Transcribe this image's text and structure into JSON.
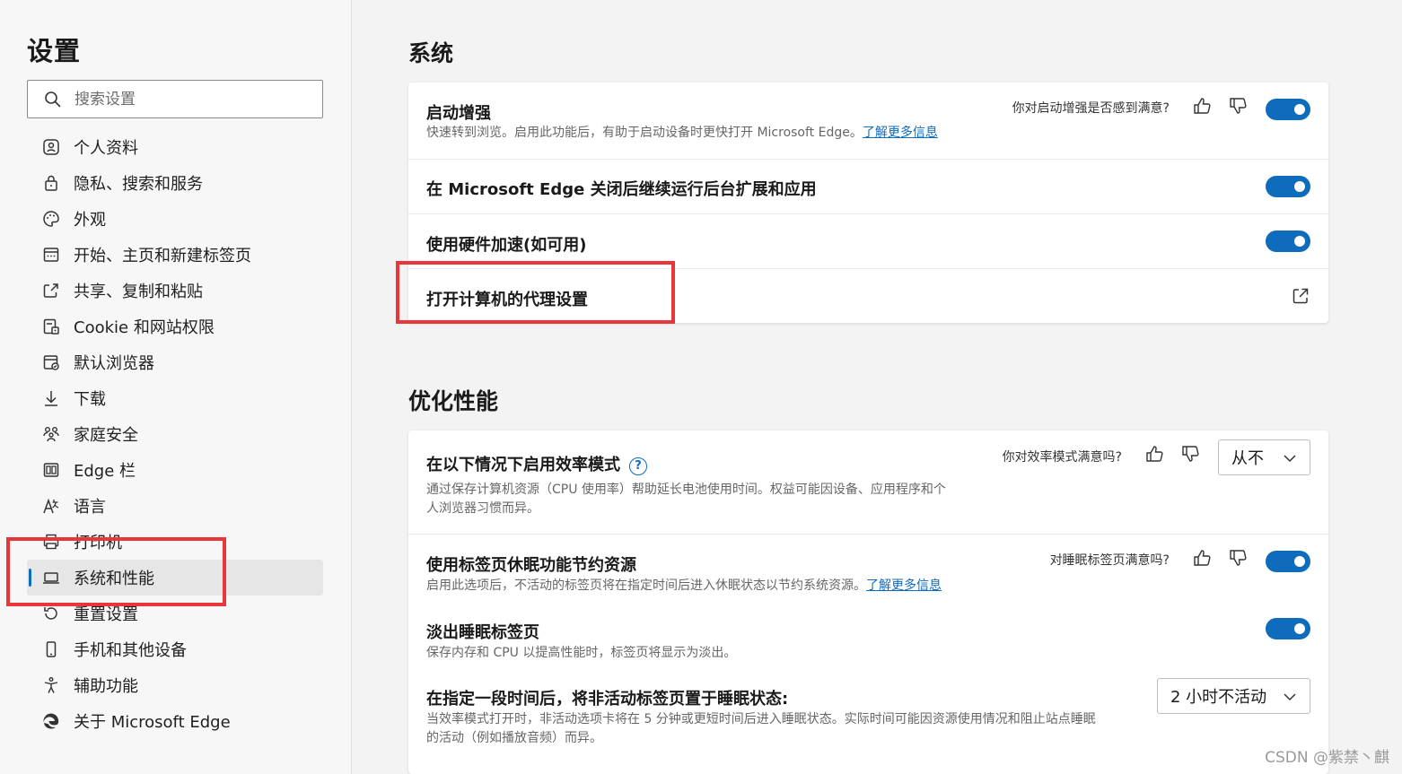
{
  "sidebar": {
    "title": "设置",
    "search_placeholder": "搜索设置",
    "items": [
      {
        "label": "个人资料",
        "icon": "profile-icon"
      },
      {
        "label": "隐私、搜索和服务",
        "icon": "lock-icon"
      },
      {
        "label": "外观",
        "icon": "palette-icon"
      },
      {
        "label": "开始、主页和新建标签页",
        "icon": "new-tab-icon"
      },
      {
        "label": "共享、复制和粘贴",
        "icon": "share-icon"
      },
      {
        "label": "Cookie 和网站权限",
        "icon": "cookie-icon"
      },
      {
        "label": "默认浏览器",
        "icon": "browser-icon"
      },
      {
        "label": "下载",
        "icon": "download-icon"
      },
      {
        "label": "家庭安全",
        "icon": "family-icon"
      },
      {
        "label": "Edge 栏",
        "icon": "edge-bar-icon"
      },
      {
        "label": "语言",
        "icon": "language-icon"
      },
      {
        "label": "打印机",
        "icon": "printer-icon"
      },
      {
        "label": "系统和性能",
        "icon": "laptop-icon",
        "active": true
      },
      {
        "label": "重置设置",
        "icon": "reset-icon"
      },
      {
        "label": "手机和其他设备",
        "icon": "phone-icon"
      },
      {
        "label": "辅助功能",
        "icon": "accessibility-icon"
      },
      {
        "label": "关于 Microsoft Edge",
        "icon": "edge-logo-icon"
      }
    ]
  },
  "system": {
    "title": "系统",
    "startup_boost": {
      "title": "启动增强",
      "desc": "快速转到浏览。启用此功能后，有助于启动设备时更快打开 Microsoft Edge。",
      "link": "了解更多信息",
      "feedback": "你对启动增强是否感到满意?",
      "enabled": true
    },
    "background": {
      "title": "在 Microsoft Edge 关闭后继续运行后台扩展和应用",
      "enabled": true
    },
    "hardware": {
      "title": "使用硬件加速(如可用)",
      "enabled": true
    },
    "proxy": {
      "title": "打开计算机的代理设置"
    }
  },
  "performance": {
    "title": "优化性能",
    "efficiency": {
      "title": "在以下情况下启用效率模式",
      "info": "?",
      "desc_line1": "通过保存计算机资源（CPU 使用率）帮助延长电池使用时间。权益可能因设备、应用程序和个",
      "desc_line2": "人浏览器习惯而异。",
      "feedback": "你对效率模式满意吗?",
      "dropdown_value": "从不"
    },
    "sleeping_tabs": {
      "title": "使用标签页休眠功能节约资源",
      "desc": "启用此选项后，不活动的标签页将在指定时间后进入休眠状态以节约系统资源。",
      "link": "了解更多信息",
      "feedback": "对睡眠标签页满意吗?",
      "enabled": true
    },
    "fade_tabs": {
      "title": "淡出睡眠标签页",
      "desc": "保存内存和 CPU 以提高性能时，标签页将显示为淡出。",
      "enabled": true
    },
    "sleep_after": {
      "title": "在指定一段时间后，将非活动标签页置于睡眠状态:",
      "desc_line1": "当效率模式打开时，非活动选项卡将在 5 分钟或更短时间后进入睡眠状态。实际时间可能因资源使用情况和阻止站点睡眠",
      "desc_line2": "的活动（例如播放音频）而异。",
      "dropdown_value": "2 小时不活动"
    }
  },
  "watermark": "CSDN @紫禁丶麒",
  "colors": {
    "accent": "#0f6cbd",
    "highlight": "#e8363b"
  }
}
